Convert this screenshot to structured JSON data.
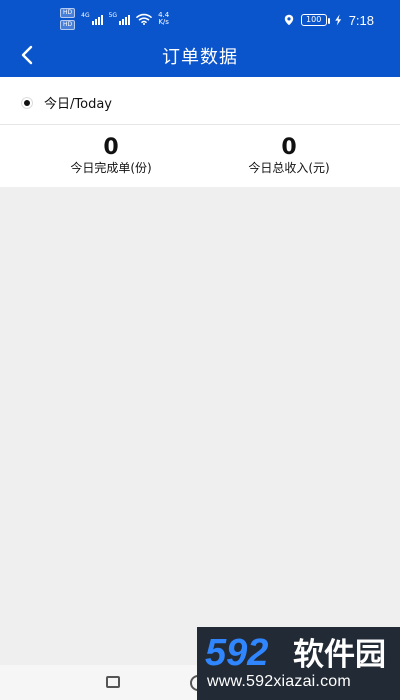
{
  "status_bar": {
    "hd_top": "HD",
    "hd_bottom": "HD",
    "net1": "4G",
    "net2": "5G",
    "speed_value": "4.4",
    "speed_unit": "K/s",
    "battery": "100",
    "time": "7:18"
  },
  "header": {
    "title": "订单数据"
  },
  "filter": {
    "option_label": "今日/Today",
    "selected": true
  },
  "stats": {
    "completed_orders_value": "0",
    "completed_orders_label": "今日完成单(份)",
    "total_income_value": "0",
    "total_income_label": "今日总收入(元)"
  },
  "watermark": {
    "logo_text": "592软件园",
    "url": "www.592xiazai.com"
  },
  "colors": {
    "header": "#0b55cc",
    "background": "#efefef",
    "watermark_bg": "#222a35",
    "watermark_blue": "#2f86ff"
  },
  "icons": {
    "back": "chevron-left-icon",
    "wifi": "wifi-icon",
    "location": "location-pin-icon",
    "battery": "battery-icon",
    "charging": "lightning-bolt-icon",
    "home": "home-circle-icon",
    "recent": "recent-square-icon"
  }
}
